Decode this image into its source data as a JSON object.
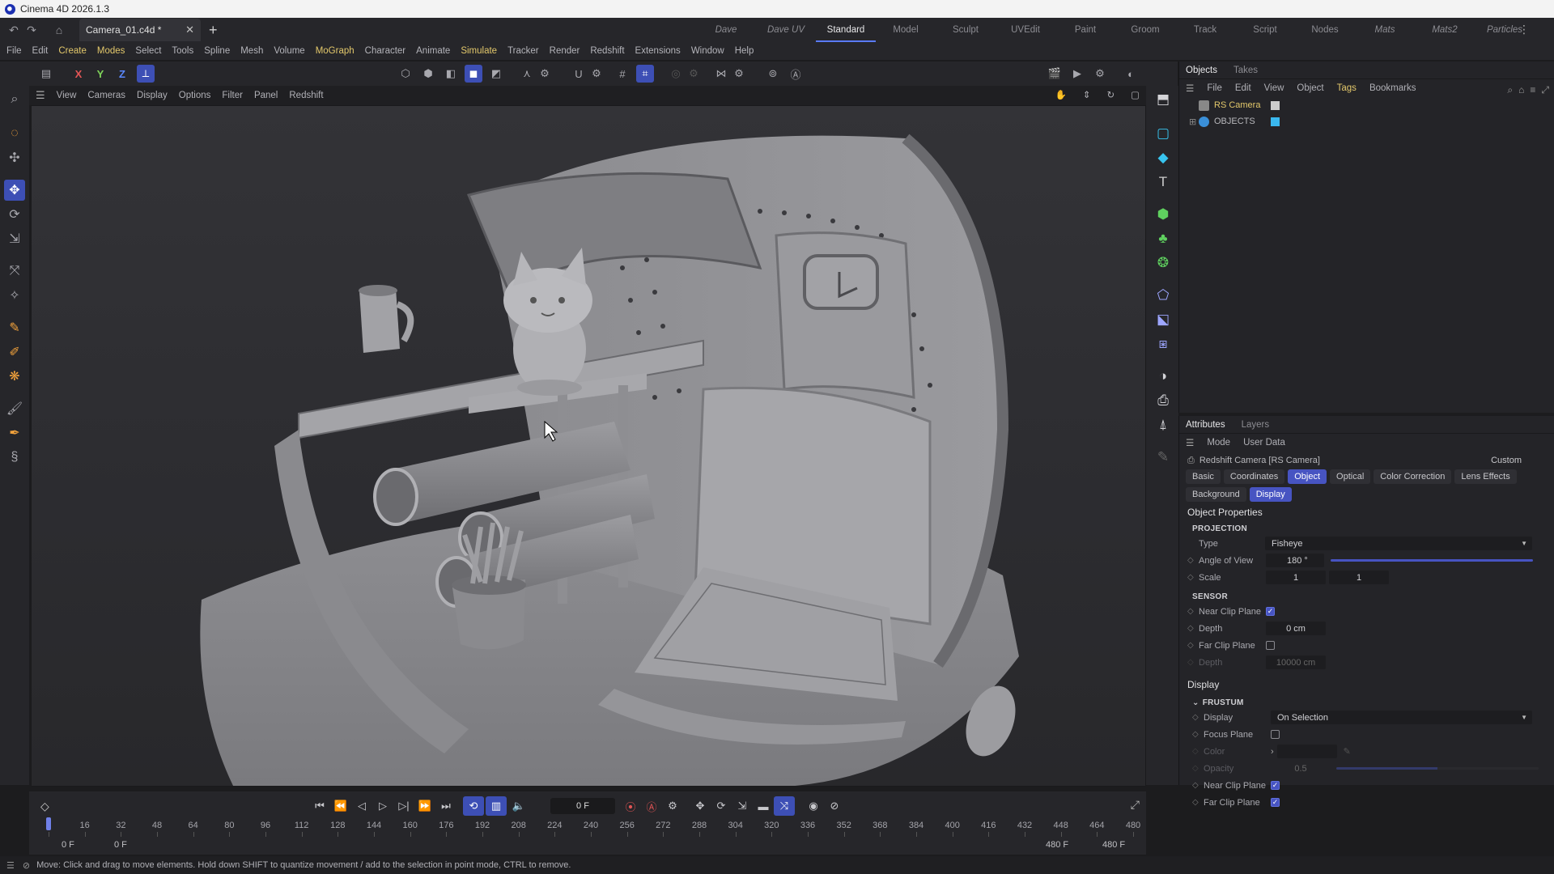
{
  "window": {
    "title": "Cinema 4D 2026.1.3"
  },
  "doc_tab": {
    "name": "Camera_01.c4d *"
  },
  "layouts": [
    {
      "label": "Dave",
      "italic": true
    },
    {
      "label": "Dave UV",
      "italic": true
    },
    {
      "label": "Standard",
      "italic": false,
      "active": true
    },
    {
      "label": "Model",
      "italic": false
    },
    {
      "label": "Sculpt",
      "italic": false
    },
    {
      "label": "UVEdit",
      "italic": false
    },
    {
      "label": "Paint",
      "italic": false
    },
    {
      "label": "Groom",
      "italic": false
    },
    {
      "label": "Track",
      "italic": false
    },
    {
      "label": "Script",
      "italic": false
    },
    {
      "label": "Nodes",
      "italic": false
    },
    {
      "label": "Mats",
      "italic": true
    },
    {
      "label": "Mats2",
      "italic": true
    },
    {
      "label": "Particles",
      "italic": true
    }
  ],
  "menu": [
    {
      "label": "File"
    },
    {
      "label": "Edit"
    },
    {
      "label": "Create",
      "hl": true
    },
    {
      "label": "Modes",
      "hl": true
    },
    {
      "label": "Select"
    },
    {
      "label": "Tools"
    },
    {
      "label": "Spline"
    },
    {
      "label": "Mesh"
    },
    {
      "label": "Volume"
    },
    {
      "label": "MoGraph",
      "hl": true
    },
    {
      "label": "Character"
    },
    {
      "label": "Animate"
    },
    {
      "label": "Simulate",
      "hl": true
    },
    {
      "label": "Tracker"
    },
    {
      "label": "Render"
    },
    {
      "label": "Redshift"
    },
    {
      "label": "Extensions"
    },
    {
      "label": "Window"
    },
    {
      "label": "Help"
    }
  ],
  "axis_buttons": {
    "x": "X",
    "y": "Y",
    "z": "Z"
  },
  "viewport_menu": [
    "View",
    "Cameras",
    "Display",
    "Options",
    "Filter",
    "Panel",
    "Redshift"
  ],
  "objects_panel": {
    "tabs": [
      "Objects",
      "Takes"
    ],
    "menu": [
      {
        "label": "File"
      },
      {
        "label": "Edit"
      },
      {
        "label": "View"
      },
      {
        "label": "Object"
      },
      {
        "label": "Tags",
        "hl": true
      },
      {
        "label": "Bookmarks"
      }
    ],
    "items": [
      {
        "name": "RS Camera",
        "color": "#e3c86b",
        "icon": "camera-icon"
      },
      {
        "name": "OBJECTS",
        "color": "#b8b8bc",
        "icon": "null-object-icon"
      }
    ]
  },
  "attributes_panel": {
    "tabs": [
      "Attributes",
      "Layers"
    ],
    "menu": [
      "Mode",
      "User Data"
    ],
    "object_title": "Redshift Camera [RS Camera]",
    "preset": "Custom",
    "buttons": [
      {
        "label": "Basic"
      },
      {
        "label": "Coordinates"
      },
      {
        "label": "Object",
        "active": true
      },
      {
        "label": "Optical"
      },
      {
        "label": "Color Correction"
      },
      {
        "label": "Lens Effects"
      },
      {
        "label": "Background"
      },
      {
        "label": "Display",
        "active": true
      }
    ],
    "section_object": "Object Properties",
    "projection": {
      "header": "PROJECTION",
      "type_label": "Type",
      "type_value": "Fisheye",
      "aov_label": "Angle of View",
      "aov_value": "180 °",
      "aov_fraction": 1.0,
      "scale_label": "Scale",
      "scale_x": "1",
      "scale_y": "1"
    },
    "sensor": {
      "header": "SENSOR",
      "near_clip_label": "Near Clip Plane",
      "near_clip": true,
      "depth_label": "Depth",
      "depth_value": "0 cm",
      "far_clip_label": "Far Clip Plane",
      "far_clip": false,
      "far_depth_label": "Depth",
      "far_depth_value": "10000 cm"
    },
    "section_display": "Display",
    "frustum": {
      "header": "FRUSTUM",
      "display_label": "Display",
      "display_value": "On Selection",
      "focus_label": "Focus Plane",
      "focus": false,
      "color_label": "Color",
      "opacity_label": "Opacity",
      "opacity_value": "0.5",
      "opacity_fraction": 0.5,
      "near_label": "Near Clip Plane",
      "near": true,
      "far_label": "Far Clip Plane",
      "far": true
    }
  },
  "timeline": {
    "current_frame": "0 F",
    "ticks": [
      "0",
      "16",
      "32",
      "48",
      "64",
      "80",
      "96",
      "112",
      "128",
      "144",
      "160",
      "176",
      "192",
      "208",
      "224",
      "240",
      "256",
      "272",
      "288",
      "304",
      "320",
      "336",
      "352",
      "368",
      "384",
      "400",
      "416",
      "432",
      "448",
      "464",
      "480"
    ],
    "start_a": "0 F",
    "start_b": "0 F",
    "end_a": "480 F",
    "end_b": "480 F",
    "playhead_frame": 0,
    "frame_max": 480
  },
  "status": {
    "text": "Move: Click and drag to move elements. Hold down SHIFT to quantize movement / add to the selection in point mode, CTRL to remove."
  },
  "colors": {
    "accent": "#4754c2",
    "highlight": "#e3c86b"
  }
}
